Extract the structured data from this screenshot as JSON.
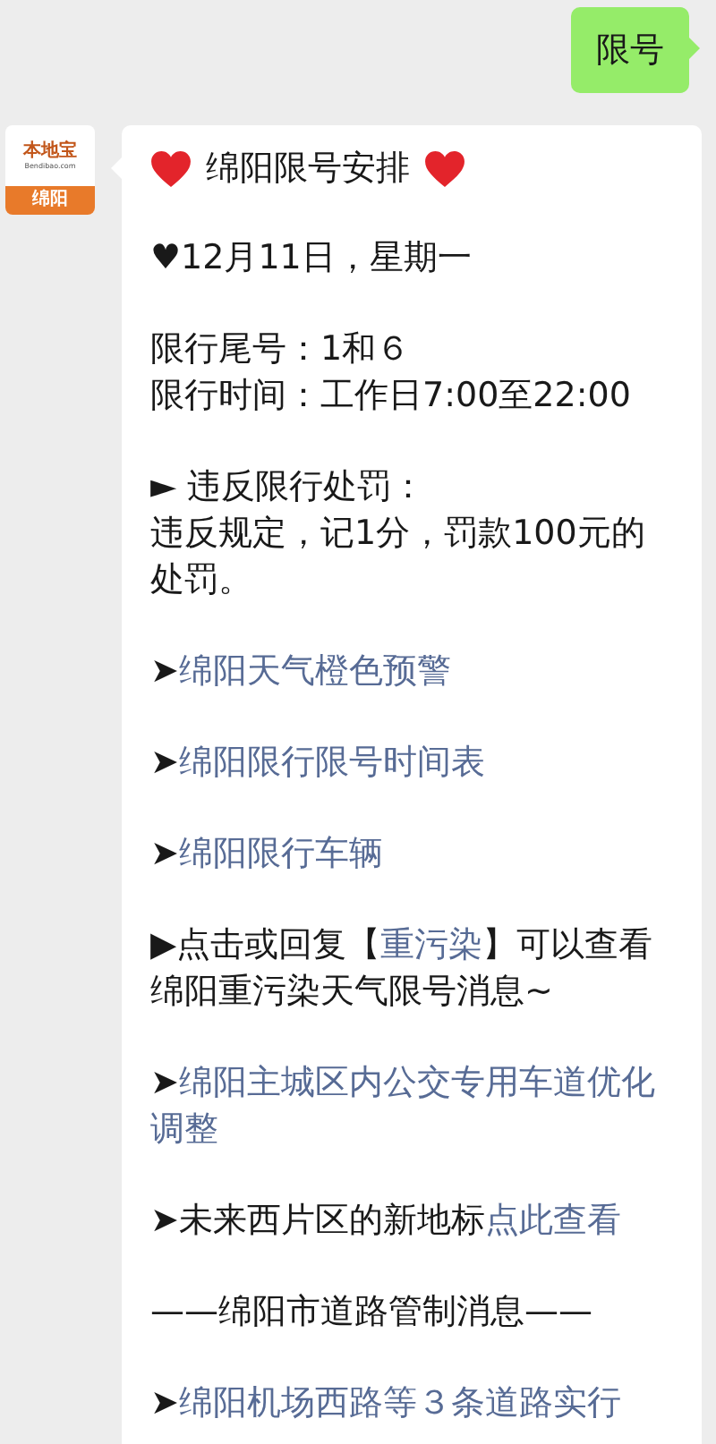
{
  "outgoing": {
    "text": "限号"
  },
  "incoming": {
    "avatar": {
      "brand": "本地宝",
      "domain": "Bendibao.com",
      "city": "绵阳"
    },
    "title": "绵阳限号安排",
    "blocks": [
      {
        "lines": [
          {
            "parts": [
              {
                "kind": "text",
                "text": "♥12月11日，星期一"
              }
            ]
          }
        ]
      },
      {
        "lines": [
          {
            "parts": [
              {
                "kind": "text",
                "text": "限行尾号：1和６"
              }
            ]
          },
          {
            "parts": [
              {
                "kind": "text",
                "text": "限行时间：工作日7:00至22:00"
              }
            ]
          }
        ]
      },
      {
        "lines": [
          {
            "parts": [
              {
                "kind": "text",
                "text": "► 违反限行处罚："
              }
            ]
          },
          {
            "parts": [
              {
                "kind": "text",
                "text": "违反规定，记1分，罚款100元的处罚。"
              }
            ]
          }
        ]
      },
      {
        "lines": [
          {
            "parts": [
              {
                "kind": "bullet",
                "text": "➤"
              },
              {
                "kind": "link",
                "text": "绵阳天气橙色预警"
              }
            ]
          }
        ]
      },
      {
        "lines": [
          {
            "parts": [
              {
                "kind": "bullet",
                "text": "➤"
              },
              {
                "kind": "link",
                "text": "绵阳限行限号时间表"
              }
            ]
          }
        ]
      },
      {
        "lines": [
          {
            "parts": [
              {
                "kind": "bullet",
                "text": "➤"
              },
              {
                "kind": "link",
                "text": "绵阳限行车辆"
              }
            ]
          }
        ]
      },
      {
        "lines": [
          {
            "parts": [
              {
                "kind": "text",
                "text": "▶点击或回复【"
              },
              {
                "kind": "link",
                "text": "重污染"
              },
              {
                "kind": "text",
                "text": "】可以查看绵阳重污染天气限号消息~"
              }
            ]
          }
        ]
      },
      {
        "lines": [
          {
            "parts": [
              {
                "kind": "bullet",
                "text": "➤"
              },
              {
                "kind": "link",
                "text": "绵阳主城区内公交专用车道优化调整"
              }
            ]
          }
        ]
      },
      {
        "lines": [
          {
            "parts": [
              {
                "kind": "text",
                "text": "➤未来西片区的新地标"
              },
              {
                "kind": "link",
                "text": "点此查看"
              }
            ]
          }
        ]
      },
      {
        "lines": [
          {
            "parts": [
              {
                "kind": "text",
                "text": "——绵阳市道路管制消息——"
              }
            ]
          }
        ]
      },
      {
        "lines": [
          {
            "parts": [
              {
                "kind": "bullet",
                "text": "➤"
              },
              {
                "kind": "link",
                "text": "绵阳机场西路等３条道路实行"
              }
            ]
          }
        ]
      }
    ]
  }
}
